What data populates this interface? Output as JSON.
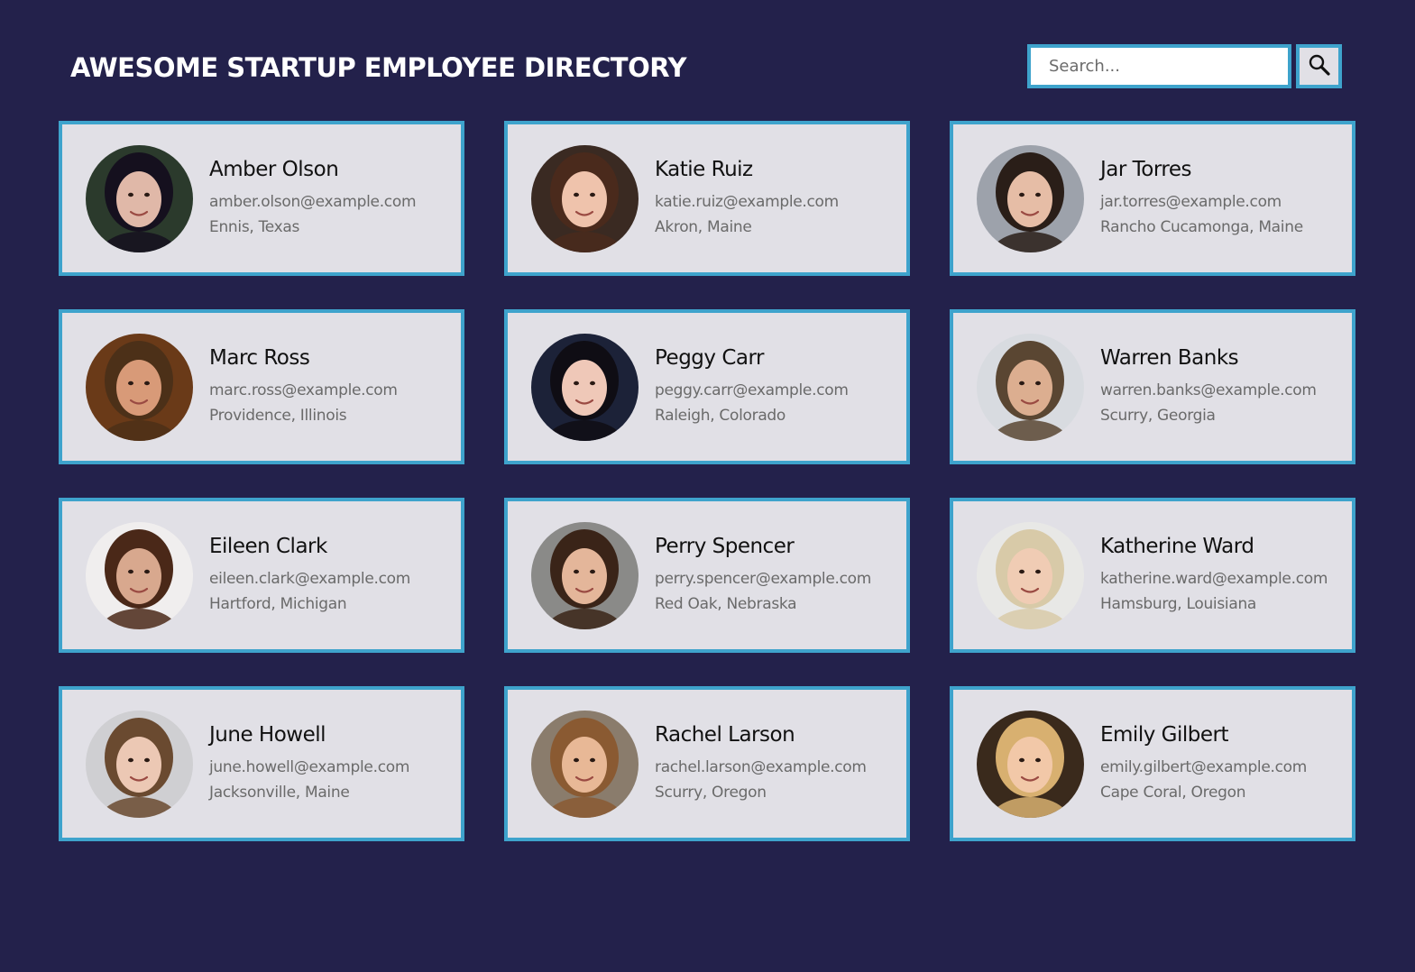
{
  "header": {
    "title": "AWESOME STARTUP EMPLOYEE DIRECTORY"
  },
  "search": {
    "placeholder": "Search...",
    "button_icon": "search-icon"
  },
  "colors": {
    "background": "#23214b",
    "card_background": "#e1e0e6",
    "accent_border": "#3ea3cc"
  },
  "employees": [
    {
      "name": "Amber Olson",
      "email": "amber.olson@example.com",
      "location": "Ennis, Texas",
      "photo": {
        "bg": "#2b3a2c",
        "hair": "#15101e",
        "skin": "#e0b8a8"
      }
    },
    {
      "name": "Katie Ruiz",
      "email": "katie.ruiz@example.com",
      "location": "Akron, Maine",
      "photo": {
        "bg": "#3a2a22",
        "hair": "#4a2a1c",
        "skin": "#efc3ac"
      }
    },
    {
      "name": "Jar Torres",
      "email": "jar.torres@example.com",
      "location": "Rancho Cucamonga, Maine",
      "photo": {
        "bg": "#9da2ab",
        "hair": "#2a1e18",
        "skin": "#e6bda6"
      }
    },
    {
      "name": "Marc Ross",
      "email": "marc.ross@example.com",
      "location": "Providence, Illinois",
      "photo": {
        "bg": "#6a3a18",
        "hair": "#4c3018",
        "skin": "#d89a78"
      }
    },
    {
      "name": "Peggy Carr",
      "email": "peggy.carr@example.com",
      "location": "Raleigh, Colorado",
      "photo": {
        "bg": "#1c2238",
        "hair": "#0f0d14",
        "skin": "#efc8b8"
      }
    },
    {
      "name": "Warren Banks",
      "email": "warren.banks@example.com",
      "location": "Scurry, Georgia",
      "photo": {
        "bg": "#d8dbe0",
        "hair": "#5a4632",
        "skin": "#dcae90"
      }
    },
    {
      "name": "Eileen Clark",
      "email": "eileen.clark@example.com",
      "location": "Hartford, Michigan",
      "photo": {
        "bg": "#f0eeee",
        "hair": "#4a2818",
        "skin": "#d8a88e"
      }
    },
    {
      "name": "Perry Spencer",
      "email": "perry.spencer@example.com",
      "location": "Red Oak, Nebraska",
      "photo": {
        "bg": "#8a8a88",
        "hair": "#3a2418",
        "skin": "#e4b69a"
      }
    },
    {
      "name": "Katherine Ward",
      "email": "katherine.ward@example.com",
      "location": "Hamsburg, Louisiana",
      "photo": {
        "bg": "#e8e8e6",
        "hair": "#d8caa8",
        "skin": "#f0ccb4"
      }
    },
    {
      "name": "June Howell",
      "email": "june.howell@example.com",
      "location": "Jacksonville, Maine",
      "photo": {
        "bg": "#cfcfd2",
        "hair": "#6a4a30",
        "skin": "#ecc8b4"
      }
    },
    {
      "name": "Rachel Larson",
      "email": "rachel.larson@example.com",
      "location": "Scurry, Oregon",
      "photo": {
        "bg": "#8a7c6c",
        "hair": "#8a5a32",
        "skin": "#e8b896"
      }
    },
    {
      "name": "Emily Gilbert",
      "email": "emily.gilbert@example.com",
      "location": "Cape Coral, Oregon",
      "photo": {
        "bg": "#3a2a1c",
        "hair": "#d8b070",
        "skin": "#f2c8a8"
      }
    }
  ]
}
